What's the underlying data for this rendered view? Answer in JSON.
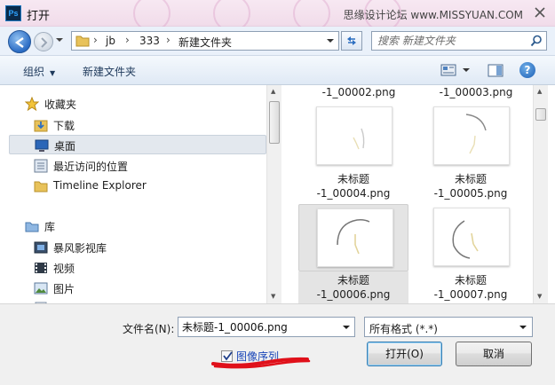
{
  "window": {
    "title": "打开",
    "app_icon": "Ps",
    "watermark": "思缘设计论坛 www.MISSYUAN.COM"
  },
  "address": {
    "crumbs": [
      "jb",
      "333",
      "新建文件夹"
    ],
    "search_placeholder": "搜索 新建文件夹"
  },
  "toolbar": {
    "organize": "组织",
    "new_folder": "新建文件夹"
  },
  "nav": {
    "favorites_header": "收藏夹",
    "favorites": [
      "下载",
      "桌面",
      "最近访问的位置",
      "Timeline Explorer"
    ],
    "selected": "桌面",
    "library_header": "库",
    "libraries": [
      "暴风影视库",
      "视频",
      "图片"
    ]
  },
  "files": {
    "top_partial": [
      "-1_00002.png",
      "-1_00003.png"
    ],
    "items": [
      {
        "line1": "未标题",
        "line2": "-1_00004.png",
        "selected": false
      },
      {
        "line1": "未标题",
        "line2": "-1_00005.png",
        "selected": false
      },
      {
        "line1": "未标题",
        "line2": "-1_00006.png",
        "selected": true
      },
      {
        "line1": "未标题",
        "line2": "-1_00007.png",
        "selected": false
      }
    ]
  },
  "bottom": {
    "filename_label": "文件名(N):",
    "filename_value": "未标题-1_00006.png",
    "filetype_value": "所有格式 (*.*)",
    "image_sequence_label": "图像序列",
    "image_sequence_checked": true,
    "open_label": "打开(O)",
    "cancel_label": "取消"
  },
  "colors": {
    "accent": "#1a46b8",
    "annotation": "#e0101a",
    "selection": "#e3e8ee"
  }
}
